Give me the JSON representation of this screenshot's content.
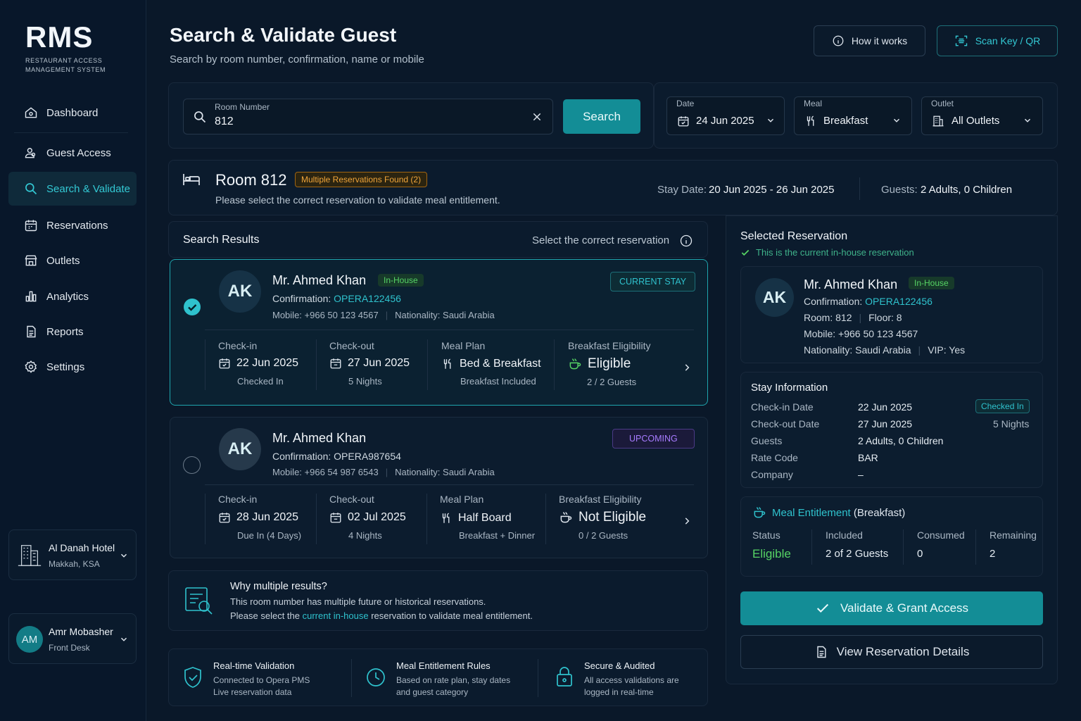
{
  "brand": {
    "title": "RMS",
    "subtitle_line1": "RESTAURANT ACCESS",
    "subtitle_line2": "MANAGEMENT SYSTEM"
  },
  "nav": [
    {
      "label": "Dashboard",
      "icon": "home-icon"
    },
    {
      "label": "Guest Access",
      "icon": "users-icon"
    },
    {
      "label": "Search & Validate",
      "icon": "search-icon",
      "active": true
    },
    {
      "label": "Reservations",
      "icon": "calendar-icon"
    },
    {
      "label": "Outlets",
      "icon": "store-icon"
    },
    {
      "label": "Analytics",
      "icon": "bar-chart-icon"
    },
    {
      "label": "Reports",
      "icon": "document-icon"
    },
    {
      "label": "Settings",
      "icon": "gear-icon"
    }
  ],
  "hotel": {
    "name": "Al Danah Hotel",
    "location": "Makkah, KSA"
  },
  "user": {
    "initials": "AM",
    "name": "Amr Mobasher",
    "role": "Front Desk"
  },
  "page": {
    "title": "Search & Validate Guest",
    "subtitle": "Search by room number, confirmation, name or mobile"
  },
  "header_buttons": {
    "how": "How it works",
    "scan": "Scan Key / QR"
  },
  "search": {
    "label": "Room Number",
    "value": "812",
    "button": "Search"
  },
  "filters": {
    "date": {
      "label": "Date",
      "value": "24 Jun 2025"
    },
    "meal": {
      "label": "Meal",
      "value": "Breakfast"
    },
    "outlet": {
      "label": "Outlet",
      "value": "All Outlets"
    }
  },
  "room": {
    "title": "Room 812",
    "badge": "Multiple Reservations Found (2)",
    "note": "Please select the correct reservation to validate meal entitlement.",
    "stay_label": "Stay Date:",
    "stay_value": "20 Jun 2025 - 26 Jun 2025",
    "guests_label": "Guests:",
    "guests_value": "2 Adults, 0 Children"
  },
  "results": {
    "title": "Search Results",
    "hint": "Select the correct reservation",
    "items": [
      {
        "initials": "AK",
        "name": "Mr. Ahmed Khan",
        "status": "In-House",
        "conf_label": "Confirmation:",
        "conf": "OPERA122456",
        "mobile": "Mobile: +966 50 123 4567",
        "nationality": "Nationality: Saudi Arabia",
        "tag": "CURRENT STAY",
        "checkin_label": "Check-in",
        "checkin": "22 Jun 2025",
        "checkin_sub": "Checked In",
        "checkout_label": "Check-out",
        "checkout": "27 Jun 2025",
        "checkout_sub": "5 Nights",
        "meal_label": "Meal Plan",
        "meal": "Bed & Breakfast",
        "meal_sub": "Breakfast Included",
        "elig_label": "Breakfast Eligibility",
        "elig": "Eligible",
        "elig_sub": "2 / 2 Guests"
      },
      {
        "initials": "AK",
        "name": "Mr. Ahmed Khan",
        "conf_label": "Confirmation:",
        "conf": "OPERA987654",
        "mobile": "Mobile: +966 54 987 6543",
        "nationality": "Nationality: Saudi Arabia",
        "tag": "UPCOMING",
        "checkin_label": "Check-in",
        "checkin": "28 Jun 2025",
        "checkin_sub": "Due In (4 Days)",
        "checkout_label": "Check-out",
        "checkout": "02 Jul 2025",
        "checkout_sub": "4 Nights",
        "meal_label": "Meal Plan",
        "meal": "Half Board",
        "meal_sub": "Breakfast + Dinner",
        "elig_label": "Breakfast Eligibility",
        "elig": "Not Eligible",
        "elig_sub": "0 / 2 Guests"
      }
    ]
  },
  "why": {
    "title": "Why multiple results?",
    "line1": "This room number has multiple future or historical reservations.",
    "line2_pre": "Please select the ",
    "line2_link": "current in-house",
    "line2_post": " reservation to validate meal entitlement."
  },
  "features": [
    {
      "title": "Real-time Validation",
      "l1": "Connected to Opera PMS",
      "l2": "Live reservation data"
    },
    {
      "title": "Meal Entitlement Rules",
      "l1": "Based on rate plan, stay dates",
      "l2": "and guest category"
    },
    {
      "title": "Secure & Audited",
      "l1": "All access validations are",
      "l2": "logged in real-time"
    }
  ],
  "selected": {
    "title": "Selected Reservation",
    "note": "This is the current in-house reservation",
    "initials": "AK",
    "name": "Mr. Ahmed Khan",
    "status": "In-House",
    "conf_label": "Confirmation:",
    "conf": "OPERA122456",
    "room": "Room: 812",
    "floor": "Floor: 8",
    "mobile": "Mobile: +966 50 123 4567",
    "nationality": "Nationality: Saudi Arabia",
    "vip": "VIP: Yes",
    "stay": {
      "title": "Stay Information",
      "rows": [
        {
          "k": "Check-in Date",
          "v": "22 Jun 2025",
          "extra": "Checked In"
        },
        {
          "k": "Check-out Date",
          "v": "27 Jun 2025",
          "extra": "5 Nights"
        },
        {
          "k": "Guests",
          "v": "2 Adults, 0 Children"
        },
        {
          "k": "Rate Code",
          "v": "BAR"
        },
        {
          "k": "Company",
          "v": "–"
        }
      ]
    },
    "meal": {
      "title": "Meal Entitlement",
      "qualifier": "(Breakfast)",
      "status_label": "Status",
      "status": "Eligible",
      "included_label": "Included",
      "included": "2 of 2 Guests",
      "consumed_label": "Consumed",
      "consumed": "0",
      "remaining_label": "Remaining",
      "remaining": "2"
    },
    "validate": "Validate & Grant Access",
    "details": "View Reservation Details"
  },
  "colors": {
    "accent": "#138d96",
    "eligible": "#56d364",
    "not_eligible": "#ff5a5a",
    "warning": "#ff9a2e",
    "upcoming": "#a77bff"
  }
}
